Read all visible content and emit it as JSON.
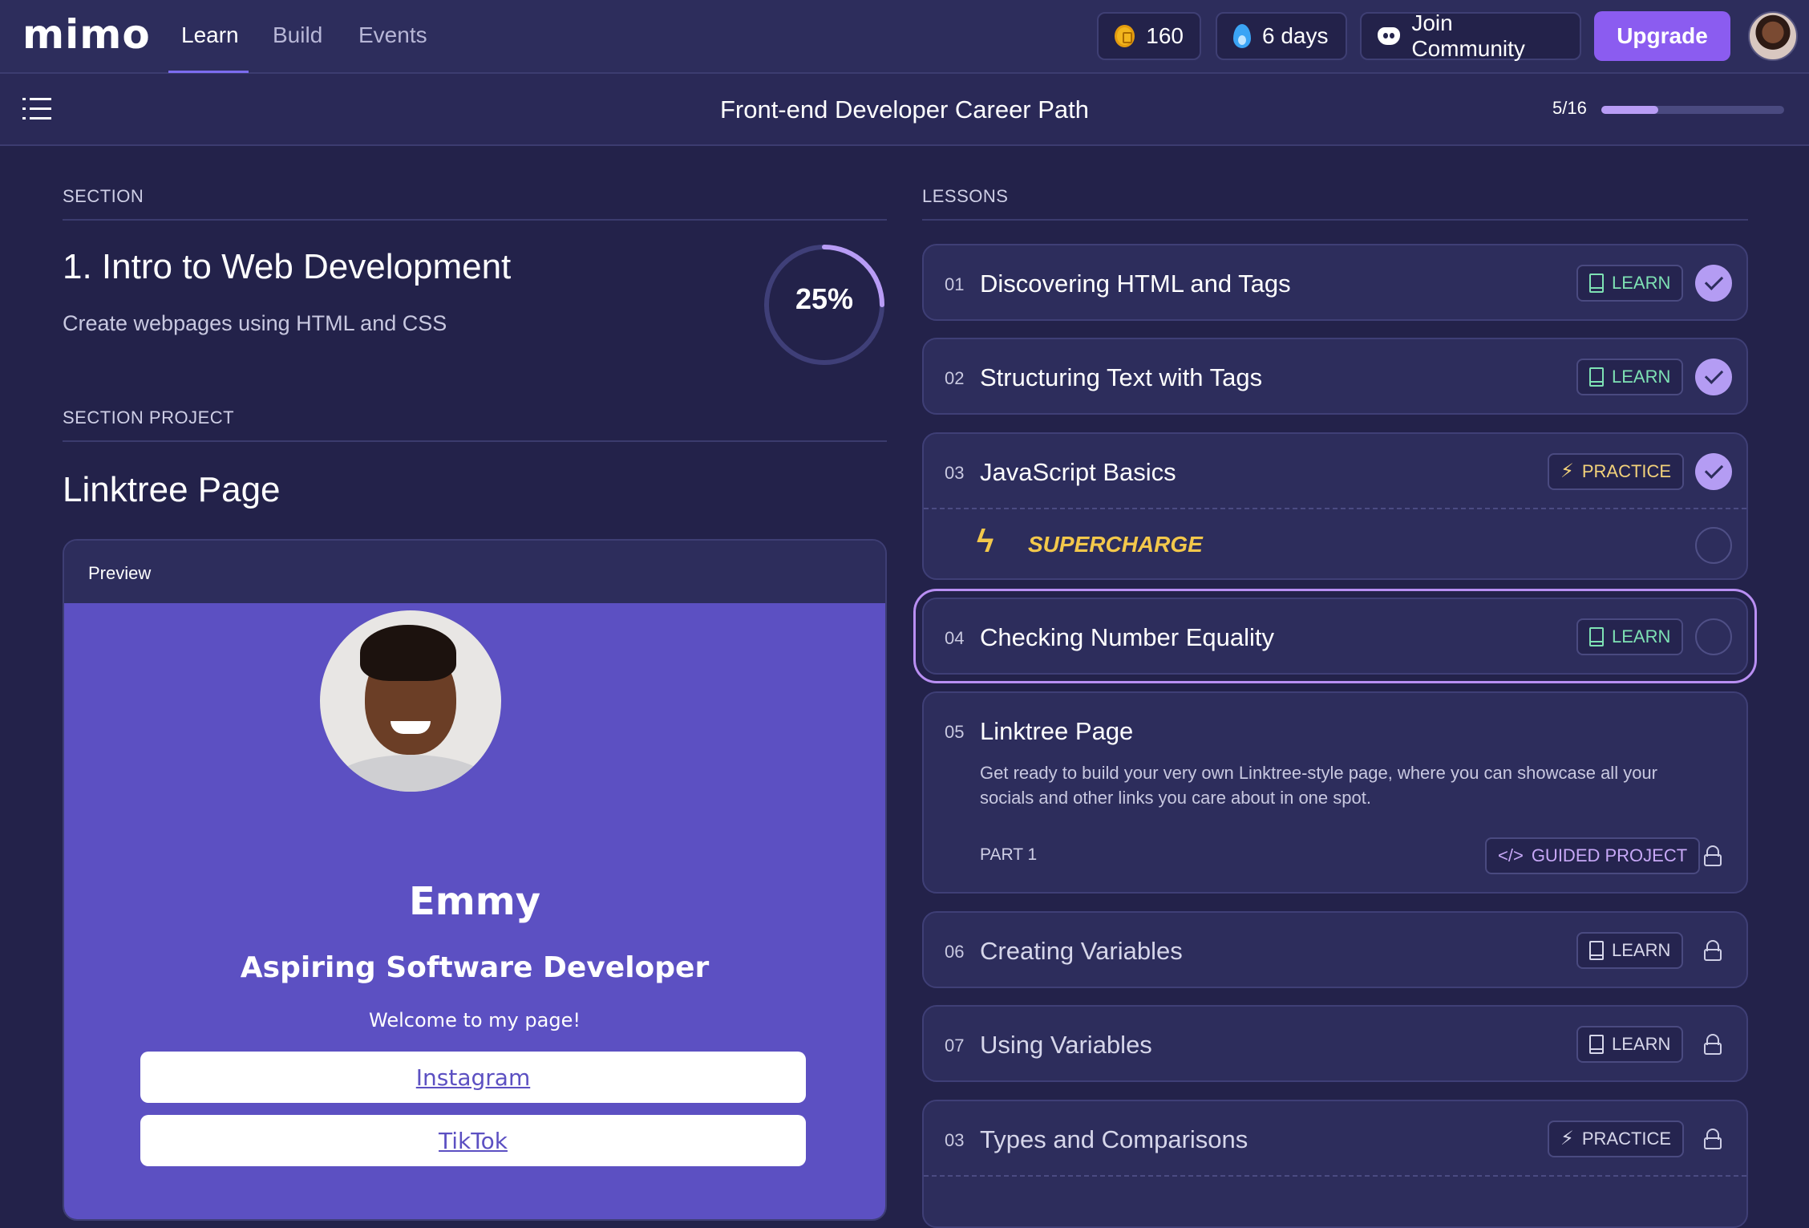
{
  "nav": {
    "logo": "mimo",
    "tabs": [
      "Learn",
      "Build",
      "Events"
    ],
    "coins": "160",
    "streak": "6 days",
    "community": "Join Community",
    "upgrade": "Upgrade"
  },
  "subheader": {
    "title": "Front-end Developer Career Path",
    "progress_text": "5/16",
    "progress_fraction": 0.3125
  },
  "section": {
    "label": "SECTION",
    "title": "1. Intro to Web Development",
    "description": "Create webpages using HTML and CSS",
    "percent_text": "25%",
    "percent": 25
  },
  "project": {
    "label": "SECTION PROJECT",
    "title": "Linktree Page"
  },
  "preview": {
    "label": "Preview",
    "name": "Emmy",
    "role": "Aspiring Software Developer",
    "welcome": "Welcome to my page!",
    "links": [
      "Instagram",
      "TikTok"
    ]
  },
  "lessons_label": "LESSONS",
  "lessons": [
    {
      "num": "01",
      "title": "Discovering HTML and Tags",
      "badge": "LEARN"
    },
    {
      "num": "02",
      "title": "Structuring Text with Tags",
      "badge": "LEARN"
    },
    {
      "num": "03",
      "title": "JavaScript Basics",
      "badge": "PRACTICE",
      "extra": "SUPERCHARGE"
    },
    {
      "num": "04",
      "title": "Checking Number Equality",
      "badge": "LEARN"
    },
    {
      "num": "05",
      "title": "Linktree Page",
      "description": "Get ready to build your very own Linktree-style page, where you can showcase all your socials and other links you care about in one spot.",
      "part": "PART 1",
      "badge": "GUIDED PROJECT"
    },
    {
      "num": "06",
      "title": "Creating Variables",
      "badge": "LEARN"
    },
    {
      "num": "07",
      "title": "Using Variables",
      "badge": "LEARN"
    },
    {
      "num": "03",
      "title": "Types and Comparisons",
      "badge": "PRACTICE"
    }
  ],
  "colors": {
    "background": "#23224a",
    "accent": "#8b5cf0",
    "learn": "#7ee2b4",
    "practice": "#f3d27a"
  }
}
